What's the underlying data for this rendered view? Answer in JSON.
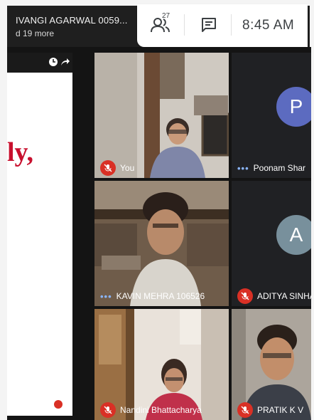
{
  "topbar": {
    "presenter_name": "IVANGI AGARWAL 0059...",
    "presenter_sub": "d 19 more",
    "people_count": "27",
    "clock": "8:45 AM"
  },
  "presentation": {
    "slide_text": "ly,"
  },
  "participants": [
    {
      "name": "You",
      "mic": "muted",
      "avatar_letter": ""
    },
    {
      "name": "Poonam Shar",
      "mic": "speaking",
      "avatar_letter": "P",
      "avatar_color": "#5c6bc0"
    },
    {
      "name": "KAVIN MEHRA 106526",
      "mic": "speaking",
      "avatar_letter": ""
    },
    {
      "name": "ADITYA SINHA",
      "mic": "muted",
      "avatar_letter": "A",
      "avatar_color": "#78909c"
    },
    {
      "name": "Nandini Bhattacharya",
      "mic": "muted",
      "avatar_letter": ""
    },
    {
      "name": "PRATIK K V",
      "mic": "muted",
      "avatar_letter": ""
    }
  ],
  "colors": {
    "muted": "#d93025",
    "speaking": "#8ab4f8",
    "bar": "#1f1f1f"
  }
}
